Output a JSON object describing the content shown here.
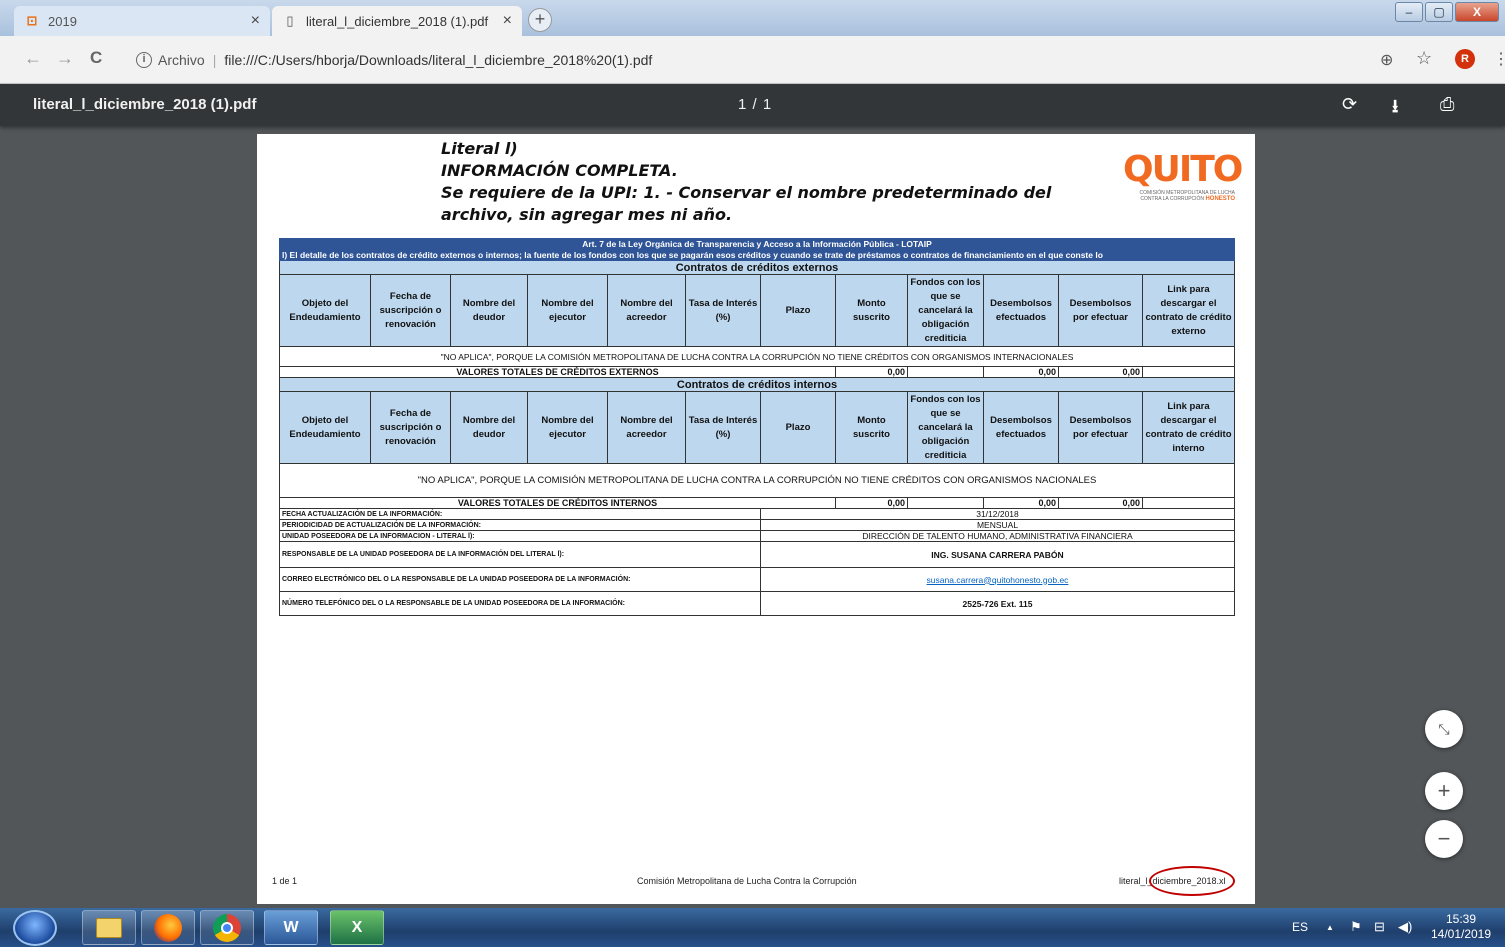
{
  "browser": {
    "tabs": [
      {
        "label": "2019",
        "icon": "grid-icon"
      },
      {
        "label": "literal_l_diciembre_2018 (1).pdf",
        "icon": "document-icon"
      }
    ],
    "close_glyph": "×",
    "new_tab": "+",
    "win": {
      "min": "–",
      "max": "▢",
      "close": "X"
    },
    "nav": {
      "back": "←",
      "forward": "→",
      "reload": "C"
    },
    "omnibox": {
      "prefix": "Archivo",
      "separator": "|",
      "url": "file:///C:/Users/hborja/Downloads/literal_l_diciembre_2018%20(1).pdf",
      "info": "i"
    },
    "icons": {
      "zoom": "⊕",
      "star": "☆",
      "menu": "⋮"
    },
    "avatar": "R"
  },
  "pdf": {
    "title": "literal_l_diciembre_2018 (1).pdf",
    "page_indicator": "1 / 1",
    "icons": {
      "rotate": "⟳",
      "download": "⭳",
      "print": "⎙"
    }
  },
  "document": {
    "heading": [
      "Literal l)",
      "INFORMACIÓN COMPLETA.",
      "Se requiere de la UPI: 1. - Conservar el nombre predeterminado del",
      "archivo, sin agregar mes ni año."
    ],
    "logo": {
      "text": "QUITO",
      "sub": "COMISIÓN METROPOLITANA DE LUCHA CONTRA LA CORRUPCIÓN",
      "brand": "HONESTO"
    },
    "banner1": "Art. 7 de la Ley Orgánica de Transparencia y Acceso a la Información Pública - LOTAIP",
    "banner2": "l) El detalle de los contratos de crédito externos o internos; la fuente de los fondos con los que se pagarán esos créditos y cuando se trate de préstamos o contratos de financiamiento en el que conste lo",
    "ext_title": "Contratos de créditos externos",
    "int_title": "Contratos de créditos internos",
    "cols_ext": [
      "Objeto del Endeudamiento",
      "Fecha de suscripción o renovación",
      "Nombre del deudor",
      "Nombre del ejecutor",
      "Nombre del acreedor",
      "Tasa de Interés (%)",
      "Plazo",
      "Monto suscrito",
      "Fondos con los que se cancelará la obligación crediticia",
      "Desembolsos efectuados",
      "Desembolsos por efectuar",
      "Link para descargar el contrato de crédito externo"
    ],
    "cols_int": [
      "Objeto del Endeudamiento",
      "Fecha de suscripción o renovación",
      "Nombre del deudor",
      "Nombre del ejecutor",
      "Nombre del acreedor",
      "Tasa de Interés (%)",
      "Plazo",
      "Monto suscrito",
      "Fondos con los que se cancelará la obligación crediticia",
      "Desembolsos efectuados",
      "Desembolsos por efectuar",
      "Link para descargar el contrato de crédito interno"
    ],
    "na_ext": "\"NO APLICA\", PORQUE LA COMISIÓN METROPOLITANA DE LUCHA CONTRA LA CORRUPCIÓN NO TIENE CRÉDITOS CON ORGANISMOS INTERNACIONALES",
    "na_int": "\"NO APLICA\", PORQUE LA COMISIÓN METROPOLITANA DE LUCHA CONTRA LA CORRUPCIÓN NO TIENE CRÉDITOS CON ORGANISMOS NACIONALES",
    "total_ext": {
      "label": "VALORES TOTALES DE CRÉDITOS EXTERNOS",
      "monto": "0,00",
      "efectuados": "0,00",
      "por_efectuar": "0,00"
    },
    "total_int": {
      "label": "VALORES TOTALES DE CRÉDITOS INTERNOS",
      "monto": "0,00",
      "efectuados": "0,00",
      "por_efectuar": "0,00"
    },
    "info": [
      {
        "label": "FECHA ACTUALIZACIÓN DE LA INFORMACIÓN:",
        "value": "31/12/2018"
      },
      {
        "label": "PERIODICIDAD DE ACTUALIZACIÓN DE LA INFORMACIÓN:",
        "value": "MENSUAL"
      },
      {
        "label": "UNIDAD POSEEDORA DE LA INFORMACION - LITERAL l):",
        "value": "DIRECCIÓN DE TALENTO HUMANO, ADMINISTRATIVA FINANCIERA"
      },
      {
        "label": "RESPONSABLE DE LA UNIDAD POSEEDORA DE LA INFORMACIÓN DEL LITERAL l):",
        "value": "ING. SUSANA CARRERA PABÓN"
      },
      {
        "label": "CORREO ELECTRÓNICO DEL O LA RESPONSABLE DE LA UNIDAD POSEEDORA DE LA INFORMACIÓN:",
        "value": "susana.carrera@quitohonesto.gob.ec"
      },
      {
        "label": "NÚMERO TELEFÓNICO DEL O LA RESPONSABLE DE LA UNIDAD POSEEDORA DE LA INFORMACIÓN:",
        "value": "2525-726  Ext. 115"
      }
    ],
    "footer": {
      "left": "1 de 1",
      "center": "Comisión Metropolitana de Lucha Contra la Corrupción",
      "right": "literal_l_diciembre_2018.xl"
    }
  },
  "viewer_controls": {
    "fit": "⤡",
    "zoom_in": "+",
    "zoom_out": "−"
  },
  "taskbar": {
    "apps": [
      "explorer",
      "firefox",
      "chrome",
      "word",
      "excel"
    ],
    "app_glyphs": {
      "word": "W",
      "excel": "X"
    },
    "language": "ES",
    "tray_up": "▲",
    "time": "15:39",
    "date": "14/01/2019"
  },
  "colors": {
    "banner": "#2f5597",
    "header_fill": "#bdd7ee",
    "logo": "#f06a21",
    "annotation": "#c00000"
  }
}
